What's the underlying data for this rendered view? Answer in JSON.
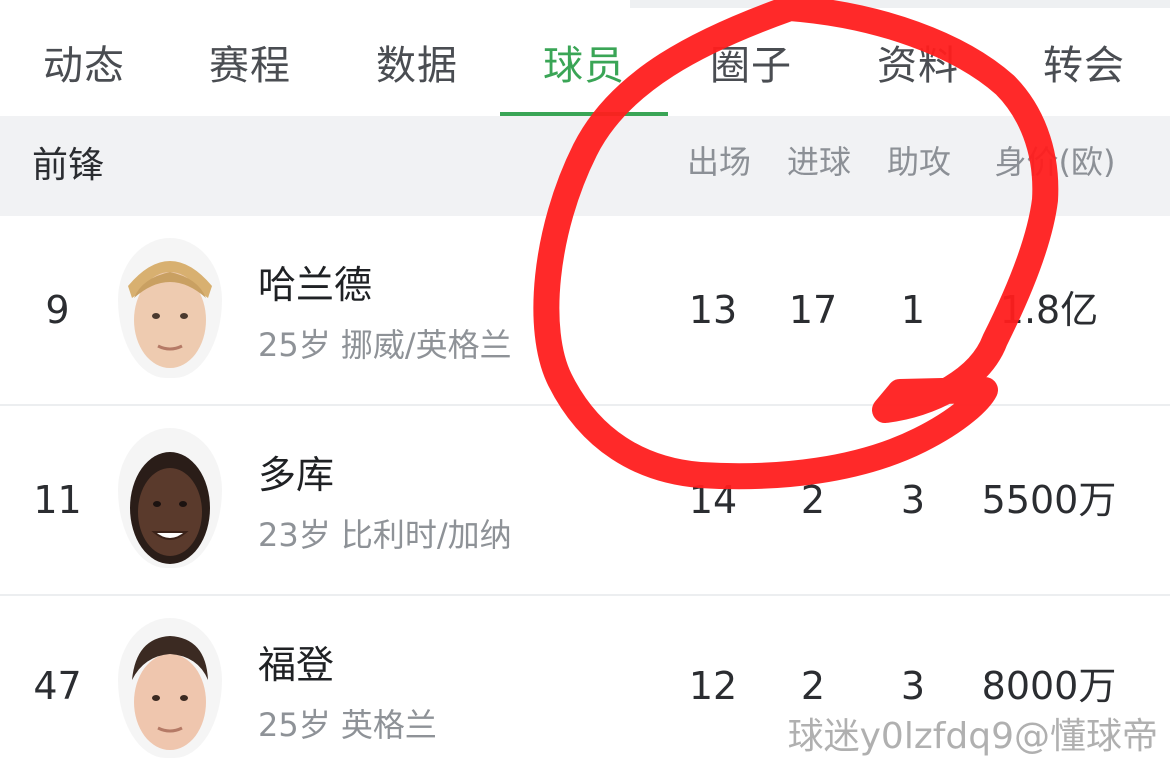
{
  "tabs": [
    {
      "label": "动态"
    },
    {
      "label": "赛程"
    },
    {
      "label": "数据"
    },
    {
      "label": "球员",
      "active": true
    },
    {
      "label": "圈子"
    },
    {
      "label": "资料"
    },
    {
      "label": "转会"
    }
  ],
  "section": {
    "title": "前锋",
    "columns": [
      "出场",
      "进球",
      "助攻",
      "身价(欧)"
    ]
  },
  "players": [
    {
      "number": "9",
      "name": "哈兰德",
      "info": "25岁 挪威/英格兰",
      "apps": "13",
      "goals": "17",
      "assists": "1",
      "value": "1.8亿",
      "avatar": "haaland-portrait"
    },
    {
      "number": "11",
      "name": "多库",
      "info": "23岁 比利时/加纳",
      "apps": "14",
      "goals": "2",
      "assists": "3",
      "value": "5500万",
      "avatar": "doku-portrait"
    },
    {
      "number": "47",
      "name": "福登",
      "info": "25岁 英格兰",
      "apps": "12",
      "goals": "2",
      "assists": "3",
      "value": "8000万",
      "avatar": "foden-portrait"
    }
  ],
  "watermark": "球迷y0lzfdq9@懂球帝",
  "colors": {
    "accent": "#3aa556",
    "annotation": "#ff1e1e",
    "section_bg": "#f1f2f4"
  }
}
